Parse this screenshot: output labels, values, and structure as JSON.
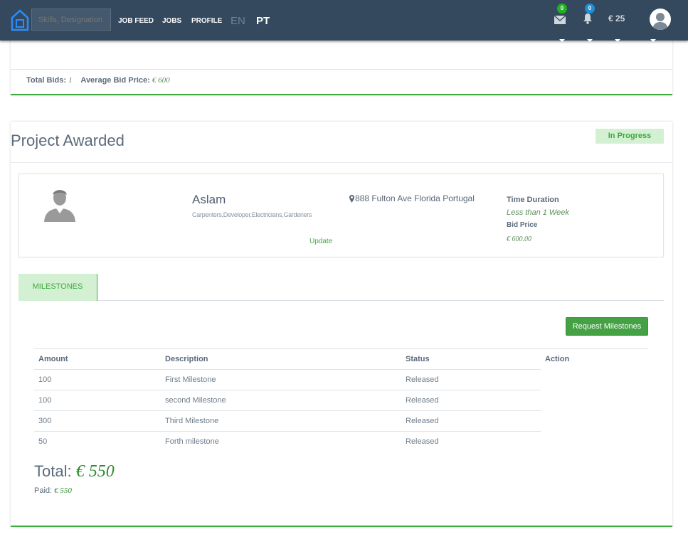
{
  "topbar": {
    "search": {
      "placeholder": "Skills, Designation"
    },
    "nav": [
      "JOB FEED",
      "JOBS",
      "PROFILE"
    ],
    "languages": [
      "EN",
      "PT"
    ],
    "messages_count": "0",
    "notifications_count": "0",
    "balance": "€ 25",
    "colors": {
      "bar": "#34495e",
      "message_badge": "#22b022",
      "notification_badge": "#1e8fd6"
    }
  },
  "bids": {
    "total_label": "Total Bids:",
    "total_value": "1",
    "avg_label": "Average Bid Price:",
    "avg_value": "€ 600"
  },
  "project": {
    "title": "Project Awarded",
    "status": "In Progress",
    "freelancer": {
      "name": "Aslam",
      "skills": "Carpenters,Developer,Electricians,Gardeners",
      "update_link": "Update",
      "address": "888 Fulton Ave Florida Portugal",
      "time_label": "Time Duration",
      "time_value": "Less than 1 Week",
      "bid_label": "Bid Price",
      "bid_value": "€ 600.00"
    },
    "tab": "MILESTONES",
    "request_button": "Request Milestones",
    "table": {
      "headers": [
        "Amount",
        "Description",
        "Status",
        "Action"
      ],
      "rows": [
        {
          "amount": "100",
          "description": "First Milestone",
          "status": "Released"
        },
        {
          "amount": "100",
          "description": "second Milestone",
          "status": "Released"
        },
        {
          "amount": "300",
          "description": "Third Milestone",
          "status": "Released"
        },
        {
          "amount": "50",
          "description": "Forth milestone",
          "status": "Released"
        }
      ]
    },
    "total_label": "Total:",
    "total_value": "€ 550",
    "paid_label": "Paid:",
    "paid_value": "€ 550",
    "accent": "#3fa83f"
  }
}
